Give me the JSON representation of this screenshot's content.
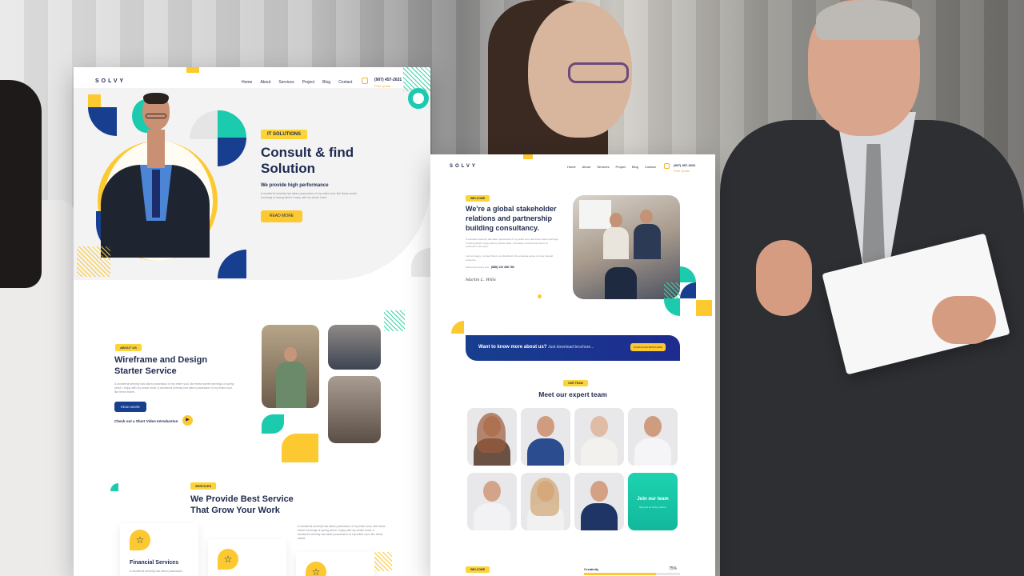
{
  "mockup_a": {
    "logo": "SOLVY",
    "nav": [
      "Home",
      "About",
      "Services",
      "Project",
      "Blog",
      "Contact"
    ],
    "phone": "(907) 457-2631",
    "phone_sub": "Free Quote",
    "hero": {
      "tag": "IT SOLUTIONS",
      "title_line1": "Consult & find",
      "title_line2": "Solution",
      "subtitle": "We provide high performance",
      "body": "A wonderful serenity has taken possession of my entire soul, like these sweet mornings of spring which I enjoy with my whole heart.",
      "button": "READ MORE"
    },
    "about": {
      "tag": "ABOUT US",
      "title_line1": "Wireframe and Design",
      "title_line2": "Starter Service",
      "body": "A wonderful serenity has taken possession of my entire soul, like these sweet mornings of spring which I enjoy with my whole heart. A wonderful serenity has taken possession of my entire soul, like these sweet.",
      "button": "READ MORE",
      "video_link": "Check out a Short Video Introduction"
    },
    "services": {
      "tag": "SERVICES",
      "title_line1": "We Provide Best Service",
      "title_line2": "That Grow Your Work",
      "body": "A wonderful serenity has taken possession of my entire soul, like these sweet mornings of spring which I enjoy with my whole heart. A wonderful serenity has taken possession of my entire soul, like these sweet.",
      "card1_title": "Financial Services",
      "card1_body": "A wonderful serenity has taken possession"
    }
  },
  "mockup_b": {
    "logo": "SOLVY",
    "nav": [
      "Home",
      "About",
      "Services",
      "Project",
      "Blog",
      "Contact"
    ],
    "phone": "(907) 457-2631",
    "phone_sub": "Free Quote",
    "intro": {
      "tag": "WELCOME",
      "title_line1": "We're a global stakeholder",
      "title_line2": "relations and partnership",
      "title_line3": "building consultancy.",
      "body1": "A wonderful serenity has taken possession of my entire soul, like these sweet mornings of spring which I enjoy with my whole heart. I am alone, and feel the charm of existence in this spot.",
      "body2": "I am so happy, my dear friend, so absorbed in the exquisite sense of mere tranquil existence.",
      "call_label": "Call us any query now",
      "call_number": "(888) 123 456 789",
      "signature": "Martin L. Wills"
    },
    "banner": {
      "text": "Want to know more about us?",
      "subtext": "Just download brochure...",
      "button": "DOWNLOAD BROCHURE"
    },
    "team": {
      "tag": "OUR TEAM",
      "title": "Meet our expert team",
      "join_title": "Join our team",
      "join_sub": "Become an Solvy partner"
    },
    "skills": {
      "tag": "WELCOME",
      "label": "Creativity",
      "percent": "75%",
      "value": 0.75
    }
  },
  "colors": {
    "navy": "#173e8f",
    "yellow": "#fdc931",
    "teal": "#1ccaae",
    "text": "#1e2b4f"
  }
}
